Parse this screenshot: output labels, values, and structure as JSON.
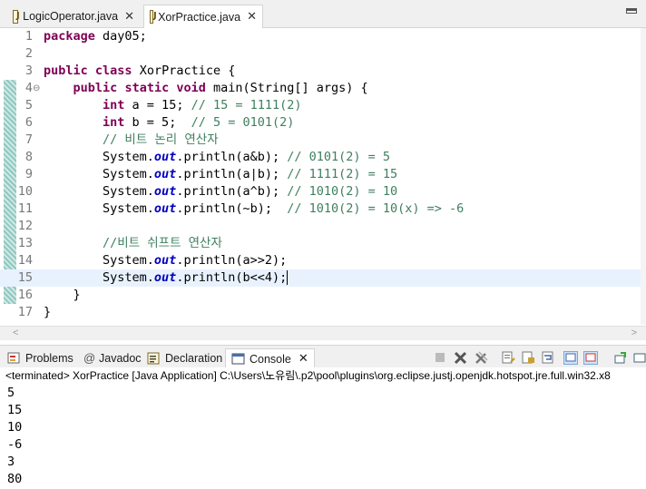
{
  "editor_tabs": [
    {
      "label": "LogicOperator.java",
      "active": false
    },
    {
      "label": "XorPractice.java",
      "active": true
    }
  ],
  "code_lines": [
    {
      "num": "1",
      "tokens": [
        {
          "t": "kw",
          "v": "package"
        },
        {
          "t": "p",
          "v": " day05;"
        }
      ]
    },
    {
      "num": "2",
      "tokens": []
    },
    {
      "num": "3",
      "tokens": [
        {
          "t": "kw",
          "v": "public"
        },
        {
          "t": "p",
          "v": " "
        },
        {
          "t": "kw",
          "v": "class"
        },
        {
          "t": "p",
          "v": " XorPractice {"
        }
      ]
    },
    {
      "num": "4",
      "fold": "⊖",
      "tokens": [
        {
          "t": "p",
          "v": "    "
        },
        {
          "t": "kw",
          "v": "public"
        },
        {
          "t": "p",
          "v": " "
        },
        {
          "t": "kw",
          "v": "static"
        },
        {
          "t": "p",
          "v": " "
        },
        {
          "t": "kw",
          "v": "void"
        },
        {
          "t": "p",
          "v": " main(String[] args) {"
        }
      ]
    },
    {
      "num": "5",
      "tokens": [
        {
          "t": "p",
          "v": "        "
        },
        {
          "t": "kw",
          "v": "int"
        },
        {
          "t": "p",
          "v": " a = 15; "
        },
        {
          "t": "cm",
          "v": "// 15 = 1111(2)"
        }
      ]
    },
    {
      "num": "6",
      "tokens": [
        {
          "t": "p",
          "v": "        "
        },
        {
          "t": "kw",
          "v": "int"
        },
        {
          "t": "p",
          "v": " b = 5;  "
        },
        {
          "t": "cm",
          "v": "// 5 = 0101(2)"
        }
      ]
    },
    {
      "num": "7",
      "tokens": [
        {
          "t": "p",
          "v": "        "
        },
        {
          "t": "cm",
          "v": "// 비트 논리 연산자"
        }
      ]
    },
    {
      "num": "8",
      "tokens": [
        {
          "t": "p",
          "v": "        System."
        },
        {
          "t": "st",
          "v": "out"
        },
        {
          "t": "p",
          "v": ".println(a&b); "
        },
        {
          "t": "cm",
          "v": "// 0101(2) = 5"
        }
      ]
    },
    {
      "num": "9",
      "tokens": [
        {
          "t": "p",
          "v": "        System."
        },
        {
          "t": "st",
          "v": "out"
        },
        {
          "t": "p",
          "v": ".println(a|b); "
        },
        {
          "t": "cm",
          "v": "// 1111(2) = 15"
        }
      ]
    },
    {
      "num": "10",
      "tokens": [
        {
          "t": "p",
          "v": "        System."
        },
        {
          "t": "st",
          "v": "out"
        },
        {
          "t": "p",
          "v": ".println(a^b); "
        },
        {
          "t": "cm",
          "v": "// 1010(2) = 10"
        }
      ]
    },
    {
      "num": "11",
      "tokens": [
        {
          "t": "p",
          "v": "        System."
        },
        {
          "t": "st",
          "v": "out"
        },
        {
          "t": "p",
          "v": ".println(~b);  "
        },
        {
          "t": "cm",
          "v": "// 1010(2) = 10(x) => -6"
        }
      ]
    },
    {
      "num": "12",
      "tokens": []
    },
    {
      "num": "13",
      "tokens": [
        {
          "t": "p",
          "v": "        "
        },
        {
          "t": "cm",
          "v": "//비트 쉬프트 연산자"
        }
      ]
    },
    {
      "num": "14",
      "tokens": [
        {
          "t": "p",
          "v": "        System."
        },
        {
          "t": "st",
          "v": "out"
        },
        {
          "t": "p",
          "v": ".println(a>>2);"
        }
      ]
    },
    {
      "num": "15",
      "current": true,
      "tokens": [
        {
          "t": "p",
          "v": "        System."
        },
        {
          "t": "st",
          "v": "out"
        },
        {
          "t": "p",
          "v": ".println(b<<4);"
        }
      ]
    },
    {
      "num": "16",
      "tokens": [
        {
          "t": "p",
          "v": "    }"
        }
      ]
    },
    {
      "num": "17",
      "tokens": [
        {
          "t": "p",
          "v": "}"
        }
      ]
    }
  ],
  "panel_tabs": [
    {
      "label": "Problems",
      "icon": "problems-icon"
    },
    {
      "label": "Javadoc",
      "icon": "javadoc-icon"
    },
    {
      "label": "Declaration",
      "icon": "declaration-icon"
    },
    {
      "label": "Console",
      "icon": "console-icon",
      "active": true
    }
  ],
  "console": {
    "status": "<terminated> XorPractice [Java Application] C:\\Users\\노유림\\.p2\\pool\\plugins\\org.eclipse.justj.openjdk.hotspot.jre.full.win32.x8",
    "output": [
      "5",
      "15",
      "10",
      "-6",
      "3",
      "80"
    ]
  },
  "colors": {
    "keyword": "#7f0055",
    "comment": "#3f7f5f",
    "static_field": "#0000c0",
    "current_line": "#e8f2fe"
  }
}
